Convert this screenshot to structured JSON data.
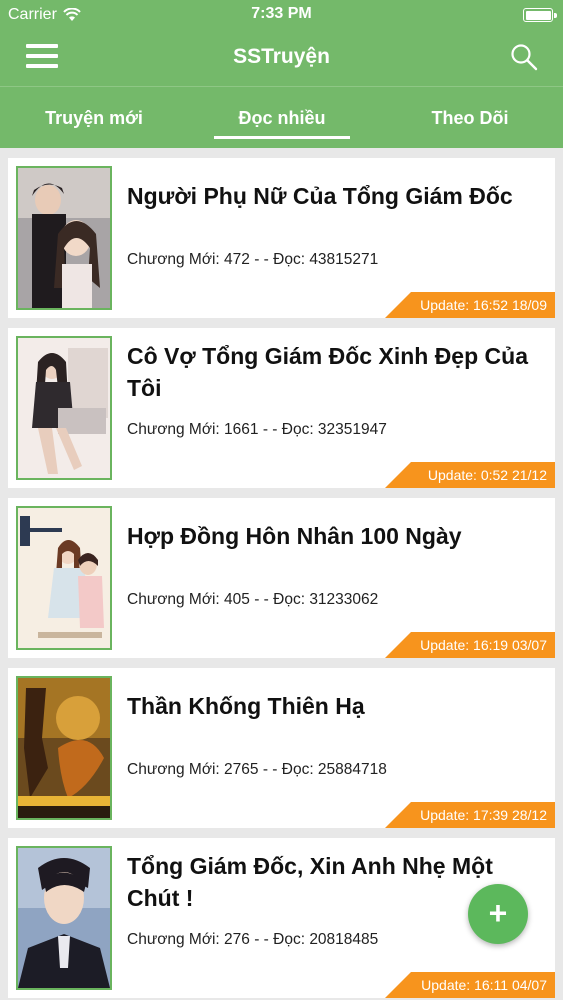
{
  "status_bar": {
    "carrier": "Carrier",
    "time": "7:33 PM"
  },
  "app_bar": {
    "title": "SSTruyện"
  },
  "tabs": [
    {
      "label": "Truyện mới",
      "active": false
    },
    {
      "label": "Đọc nhiều",
      "active": true
    },
    {
      "label": "Theo Dõi",
      "active": false
    }
  ],
  "stories": [
    {
      "title": "Người Phụ Nữ Của Tổng Giám Đốc",
      "meta": "Chương Mới: 472 -  - Đọc: 43815271",
      "update": "Update: 16:52 18/09"
    },
    {
      "title": "Cô Vợ Tổng Giám Đốc Xinh Đẹp Của Tôi",
      "meta": "Chương Mới: 1661 -  - Đọc: 32351947",
      "update": "Update: 0:52 21/12"
    },
    {
      "title": "Hợp Đồng Hôn Nhân 100 Ngày",
      "meta": "Chương Mới: 405 -  - Đọc: 31233062",
      "update": "Update: 16:19 03/07"
    },
    {
      "title": "Thần Khống Thiên Hạ",
      "meta": "Chương Mới: 2765 -  - Đọc: 25884718",
      "update": "Update: 17:39 28/12"
    },
    {
      "title": "Tổng Giám Đốc, Xin Anh Nhẹ Một Chút !",
      "meta": "Chương Mới: 276 -  - Đọc: 20818485",
      "update": "Update: 16:11 04/07"
    }
  ],
  "fab": {
    "label": "+"
  },
  "colors": {
    "primary": "#74b96a",
    "accent": "#f7941d",
    "fab": "#5cb85c"
  },
  "icons": [
    "wifi-icon",
    "battery-icon",
    "menu-icon",
    "search-icon",
    "add-icon"
  ]
}
